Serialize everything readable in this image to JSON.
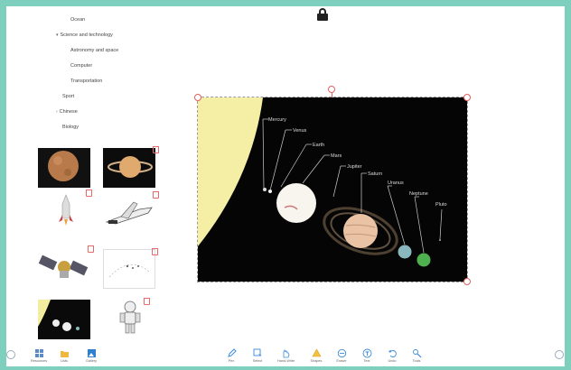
{
  "category_tree": [
    {
      "label": "Ocean",
      "indent": 2,
      "chevron": ""
    },
    {
      "label": "Science and technology",
      "indent": 1,
      "chevron": "▾"
    },
    {
      "label": "Astronomy and space",
      "indent": 2,
      "chevron": ""
    },
    {
      "label": "Computer",
      "indent": 2,
      "chevron": ""
    },
    {
      "label": "Transportation",
      "indent": 2,
      "chevron": ""
    },
    {
      "label": "Sport",
      "indent": 1,
      "chevron": ""
    },
    {
      "label": "Chinese",
      "indent": 1,
      "chevron": "›"
    },
    {
      "label": "Biology",
      "indent": 1,
      "chevron": ""
    }
  ],
  "thumbnails": [
    {
      "name": "mercury-thumb"
    },
    {
      "name": "saturn-thumb"
    },
    {
      "name": "rocket-thumb"
    },
    {
      "name": "space-shuttle-thumb"
    },
    {
      "name": "satellite-thumb"
    },
    {
      "name": "orbit-diagram-thumb"
    },
    {
      "name": "solar-system-thumb"
    },
    {
      "name": "astronaut-thumb"
    }
  ],
  "canvas": {
    "planets": [
      {
        "label": "Mercury"
      },
      {
        "label": "Venus"
      },
      {
        "label": "Earth"
      },
      {
        "label": "Mars"
      },
      {
        "label": "Jupiter"
      },
      {
        "label": "Saturn"
      },
      {
        "label": "Uranus"
      },
      {
        "label": "Neptune"
      },
      {
        "label": "Pluto"
      }
    ]
  },
  "left_tools": [
    {
      "label": "Resources",
      "icon": "grid-icon"
    },
    {
      "label": "Lists",
      "icon": "folder-icon"
    },
    {
      "label": "Gallery",
      "icon": "gallery-icon"
    }
  ],
  "bottom_tools": [
    {
      "label": "Pen",
      "icon": "pen-icon"
    },
    {
      "label": "Select",
      "icon": "select-icon"
    },
    {
      "label": "Hand-Write",
      "icon": "hand-icon"
    },
    {
      "label": "Shapes",
      "icon": "shapes-icon"
    },
    {
      "label": "Eraser",
      "icon": "eraser-icon"
    },
    {
      "label": "Text",
      "icon": "text-icon"
    },
    {
      "label": "Undo",
      "icon": "undo-icon"
    },
    {
      "label": "Tools",
      "icon": "tools-icon"
    }
  ],
  "colors": {
    "accent": "#3a8ad8",
    "frame": "#7fcfbf",
    "handle": "#e06060"
  }
}
